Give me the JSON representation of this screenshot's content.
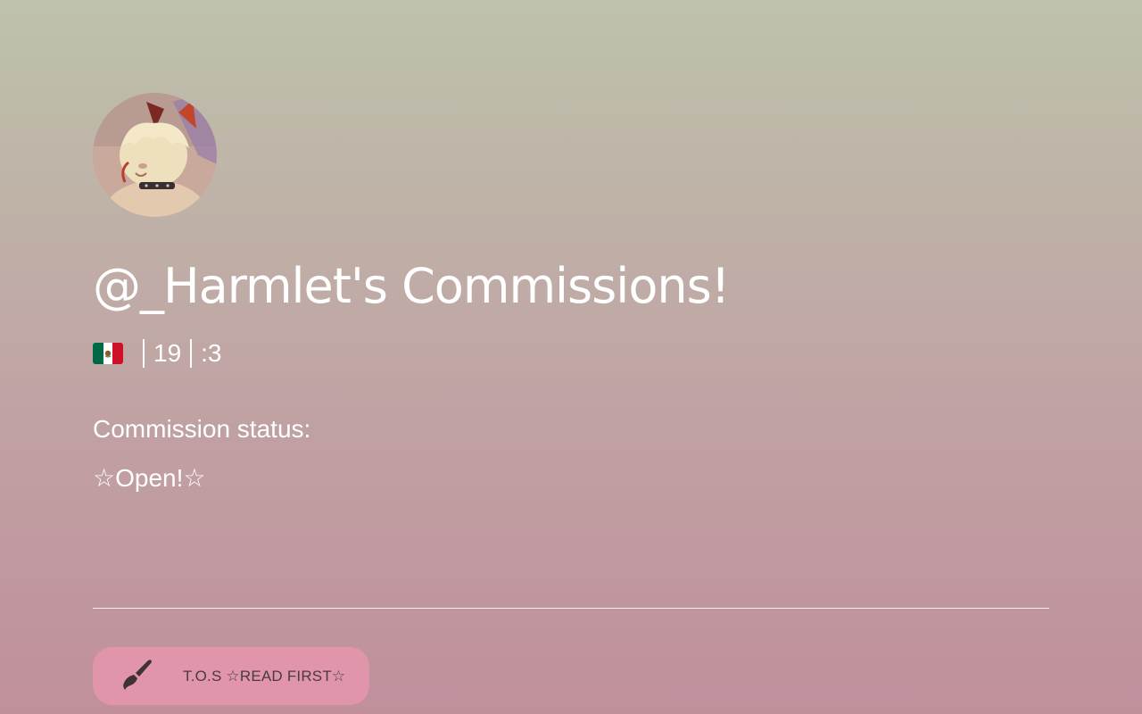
{
  "profile": {
    "title": "@_Harmlet's Commissions!",
    "subline": {
      "flag": "mexico-flag-icon",
      "age": "19",
      "emote": ":3"
    }
  },
  "bio": {
    "status_label": "Commission status:",
    "status_value": "☆Open!☆"
  },
  "links": [
    {
      "icon": "paintbrush-icon",
      "label": "T.O.S ☆READ FIRST☆"
    }
  ],
  "colors": {
    "background_top": "#bec2ac",
    "background_bottom": "#c08f9b",
    "button_background": "#e095ab",
    "text": "#ffffff",
    "button_text": "#4a3b40"
  }
}
